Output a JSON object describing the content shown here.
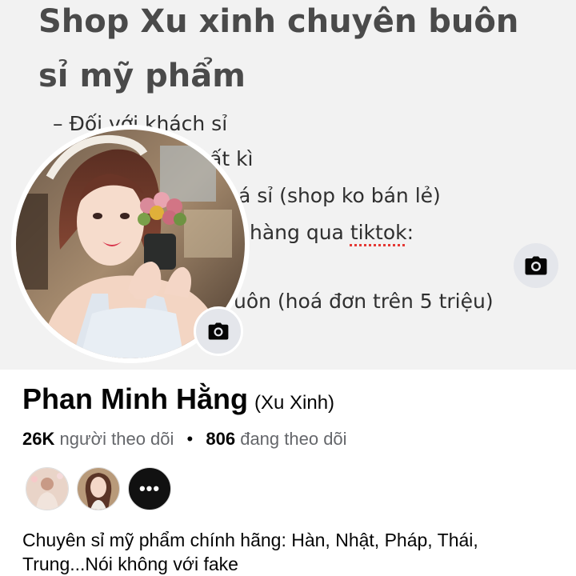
{
  "cover": {
    "title_line1": "Shop Xu xinh chuyên buôn",
    "title_line2": "sỉ mỹ phẩm",
    "line_1": "–   Đối với khách sỉ",
    "line_2": "ất kì",
    "line_3": "á sỉ (shop ko bán lẻ)",
    "line_4_prefix": "hàng qua ",
    "line_4_word": "tiktok",
    "line_4_suffix": ":",
    "line_5": "uôn (hoá đơn trên 5 triệu)",
    "camera_icon": "camera-icon"
  },
  "profile": {
    "name": "Phan Minh Hằng",
    "alt_name": "(Xu Xinh)",
    "followers_count": "26K",
    "followers_label": "người theo dõi",
    "separator": "•",
    "following_count": "806",
    "following_label": "đang theo dõi",
    "more_label": "•••",
    "bio": "Chuyên sỉ mỹ phẩm chính hãng: Hàn, Nhật, Pháp, Thái, Trung...Nói không với fake"
  },
  "colors": {
    "text_primary": "#050505",
    "text_secondary": "#65676b",
    "button_bg": "#e4e6eb",
    "spellcheck_red": "#e53935"
  }
}
